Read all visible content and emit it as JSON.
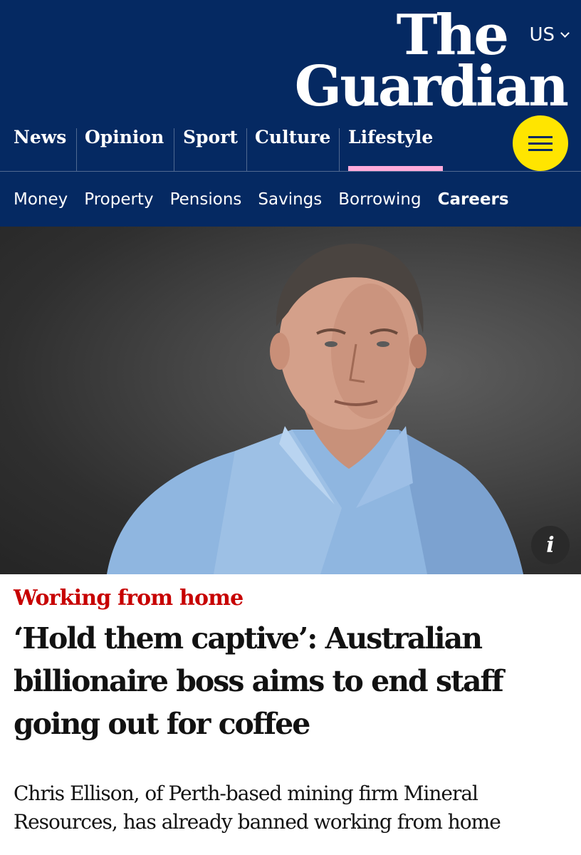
{
  "header": {
    "edition": "US",
    "logo": {
      "line1": "The",
      "line2": "Guardian"
    },
    "pillars": [
      {
        "label": "News"
      },
      {
        "label": "Opinion"
      },
      {
        "label": "Sport"
      },
      {
        "label": "Culture"
      },
      {
        "label": "Lifestyle",
        "active": true
      }
    ],
    "subnav": [
      {
        "label": "Money"
      },
      {
        "label": "Property"
      },
      {
        "label": "Pensions"
      },
      {
        "label": "Savings"
      },
      {
        "label": "Borrowing"
      },
      {
        "label": "Careers",
        "current": true
      }
    ],
    "menu_icon": "hamburger-icon"
  },
  "colors": {
    "brand": "#052962",
    "menu_button": "#ffe500",
    "lifestyle_accent": "#ffabdb",
    "kicker": "#c70000"
  },
  "article": {
    "kicker": "Working from home",
    "headline": "‘Hold them captive’: Australian billionaire boss aims to end staff going out for coffee",
    "standfirst": "Chris Ellison, of Perth-based mining firm Mineral Resources, has already banned working from home",
    "image_info_icon": "info-icon"
  }
}
